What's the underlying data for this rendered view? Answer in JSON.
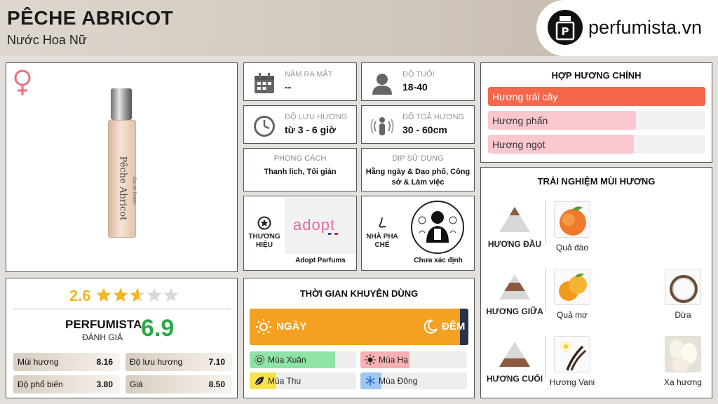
{
  "header": {
    "title": "PÊCHE ABRICOT",
    "subtitle": "Nước Hoa Nữ",
    "logo_text": "perfumista.vn"
  },
  "product": {
    "bottle_label": "Pêche Abricot",
    "bottle_small": "Eau de Toilette",
    "gender_icon": "female-icon"
  },
  "stats": {
    "year_label": "NĂM RA MẮT",
    "year_value": "--",
    "age_label": "ĐỘ TUỔI",
    "age_value": "18-40",
    "longevity_label": "ĐỘ LƯU HƯƠNG",
    "longevity_value": "từ 3 - 6 giờ",
    "sillage_label": "ĐỘ TOẢ HƯƠNG",
    "sillage_value": "30 - 60cm"
  },
  "style": {
    "label": "PHONG CÁCH",
    "value": "Thanh lịch, Tối giản"
  },
  "occasion": {
    "label": "DỊP SỬ DỤNG",
    "value": "Hằng ngày & Dạo phố, Công sở & Làm việc"
  },
  "brand": {
    "label": "THƯƠNG HIỆU",
    "logo_text": "adopt",
    "name": "Adopt Parfums"
  },
  "perfumer": {
    "label": "NHÀ PHA CHẾ",
    "name": "Chưa xác định"
  },
  "accords": {
    "title": "HỢP HƯƠNG CHÍNH",
    "items": [
      {
        "name": "Hương trái cây",
        "level": 1.0,
        "color": "#f4674b"
      },
      {
        "name": "Hương phấn",
        "level": 0.68,
        "color": "#f9c7cf"
      },
      {
        "name": "Hương ngọt",
        "level": 0.67,
        "color": "#f9c7cf"
      }
    ]
  },
  "notes": {
    "title": "TRẢI NGHIỆM MÙI HƯƠNG",
    "top_label": "HƯƠNG ĐẦU",
    "middle_label": "HƯƠNG GIỮA",
    "base_label": "HƯƠNG CUỐI",
    "top": [
      "Quả đào"
    ],
    "middle": [
      "Quả mơ",
      "Dừa"
    ],
    "base": [
      "Hương Vani",
      "Xạ hương"
    ]
  },
  "rating": {
    "value": "2.6",
    "stars": 2.6,
    "max": 5,
    "brand": "PERFUMISTA",
    "eval_label": "ĐÁNH GIÁ",
    "score": "6.9"
  },
  "scores": [
    {
      "label": "Mùi hương",
      "value": "8.16"
    },
    {
      "label": "Độ lưu hương",
      "value": "7.10"
    },
    {
      "label": "Độ phổ biến",
      "value": "3.80"
    },
    {
      "label": "Giá",
      "value": "8.50"
    }
  ],
  "time": {
    "title": "THỜI GIAN KHUYÊN DÙNG",
    "day_label": "NGÀY",
    "night_label": "ĐÊM",
    "day_fraction": 0.96,
    "seasons": [
      {
        "name": "Mùa Xuân",
        "level": 0.8,
        "color": "#8fe3a6"
      },
      {
        "name": "Mùa Hạ",
        "level": 0.46,
        "color": "#f7b0b3"
      },
      {
        "name": "Mùa Thu",
        "level": 0.25,
        "color": "#f7e24c"
      },
      {
        "name": "Mùa Đông",
        "level": 0.2,
        "color": "#9fc7f1"
      }
    ]
  },
  "colors": {
    "accent_orange": "#f5a020",
    "score_green": "#2ea84a",
    "star_gold": "#f2b622"
  }
}
